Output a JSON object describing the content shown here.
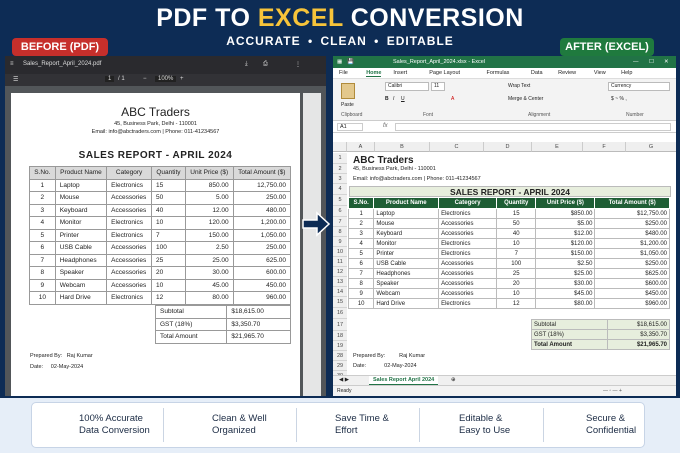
{
  "header": {
    "title_pre": "PDF TO ",
    "title_hl": "EXCEL",
    "title_post": " CONVERSION",
    "subtitle": "ACCURATE • CLEAN • EDITABLE",
    "before_label": "BEFORE (PDF)",
    "after_label": "AFTER (EXCEL)"
  },
  "pdf": {
    "filename": "Sales_Report_April_2024.pdf",
    "page": "1",
    "of": "/ 1",
    "zoom": "100%",
    "company": "ABC Traders",
    "address": "45, Business Park, Delhi - 110001",
    "contact": "Email: info@abctraders.com | Phone: 011-41234567",
    "report_title": "SALES REPORT - APRIL 2024",
    "columns": [
      "S.No.",
      "Product Name",
      "Category",
      "Quantity",
      "Unit Price ($)",
      "Total Amount ($)"
    ],
    "rows": [
      [
        "1",
        "Laptop",
        "Electronics",
        "15",
        "850.00",
        "12,750.00"
      ],
      [
        "2",
        "Mouse",
        "Accessories",
        "50",
        "5.00",
        "250.00"
      ],
      [
        "3",
        "Keyboard",
        "Accessories",
        "40",
        "12.00",
        "480.00"
      ],
      [
        "4",
        "Monitor",
        "Electronics",
        "10",
        "120.00",
        "1,200.00"
      ],
      [
        "5",
        "Printer",
        "Electronics",
        "7",
        "150.00",
        "1,050.00"
      ],
      [
        "6",
        "USB Cable",
        "Accessories",
        "100",
        "2.50",
        "250.00"
      ],
      [
        "7",
        "Headphones",
        "Accessories",
        "25",
        "25.00",
        "625.00"
      ],
      [
        "8",
        "Speaker",
        "Accessories",
        "20",
        "30.00",
        "600.00"
      ],
      [
        "9",
        "Webcam",
        "Accessories",
        "10",
        "45.00",
        "450.00"
      ],
      [
        "10",
        "Hard Drive",
        "Electronics",
        "12",
        "80.00",
        "960.00"
      ]
    ],
    "totals": [
      [
        "Subtotal",
        "$18,615.00"
      ],
      [
        "GST (18%)",
        "$3,350.70"
      ],
      [
        "Total Amount",
        "$21,965.70"
      ]
    ],
    "prepared_label": "Prepared By:",
    "prepared_value": "Raj Kumar",
    "date_label": "Date:",
    "date_value": "02-May-2024"
  },
  "excel": {
    "title": "Sales_Report_April_2024.xlsx - Excel",
    "menu": [
      "File",
      "Home",
      "Insert",
      "Page Layout",
      "Formulas",
      "Data",
      "Review",
      "View",
      "Help"
    ],
    "font": "Calibri",
    "font_size": "11",
    "number_format": "Currency",
    "wrap_text": "Wrap Text",
    "merge": "Merge & Center",
    "paste": "Paste",
    "groups": [
      "Clipboard",
      "Font",
      "Alignment",
      "Number"
    ],
    "name_box": "A1",
    "col_letters": [
      "A",
      "B",
      "C",
      "D",
      "E",
      "F",
      "G"
    ],
    "row_numbers": [
      "1",
      "2",
      "3",
      "4",
      "5",
      "6",
      "7",
      "8",
      "9",
      "10",
      "11",
      "12",
      "13",
      "14",
      "15",
      "16",
      "17",
      "18",
      "19",
      "28",
      "29",
      "30"
    ],
    "company": "ABC Traders",
    "address": "45, Business Park, Delhi - 110001",
    "contact": "Email: info@abctraders.com | Phone: 011-41234567",
    "report_title": "SALES REPORT - APRIL 2024",
    "columns": [
      "S.No.",
      "Product Name",
      "Category",
      "Quantity",
      "Unit Price ($)",
      "Total Amount ($)"
    ],
    "rows": [
      [
        "1",
        "Laptop",
        "Electronics",
        "15",
        "$850.00",
        "$12,750.00"
      ],
      [
        "2",
        "Mouse",
        "Accessories",
        "50",
        "$5.00",
        "$250.00"
      ],
      [
        "3",
        "Keyboard",
        "Accessories",
        "40",
        "$12.00",
        "$480.00"
      ],
      [
        "4",
        "Monitor",
        "Electronics",
        "10",
        "$120.00",
        "$1,200.00"
      ],
      [
        "5",
        "Printer",
        "Electronics",
        "7",
        "$150.00",
        "$1,050.00"
      ],
      [
        "6",
        "USB Cable",
        "Accessories",
        "100",
        "$2.50",
        "$250.00"
      ],
      [
        "7",
        "Headphones",
        "Accessories",
        "25",
        "$25.00",
        "$625.00"
      ],
      [
        "8",
        "Speaker",
        "Accessories",
        "20",
        "$30.00",
        "$600.00"
      ],
      [
        "9",
        "Webcam",
        "Accessories",
        "10",
        "$45.00",
        "$450.00"
      ],
      [
        "10",
        "Hard Drive",
        "Electronics",
        "12",
        "$80.00",
        "$960.00"
      ]
    ],
    "totals": [
      [
        "Subtotal",
        "$18,615.00"
      ],
      [
        "GST (18%)",
        "$3,350.70"
      ],
      [
        "Total Amount",
        "$21,965.70"
      ]
    ],
    "prepared_label": "Prepared By:",
    "prepared_value": "Raj Kumar",
    "date_label": "Date:",
    "date_value": "02-May-2024",
    "sheet_tab": "Sales Report April 2024",
    "status": "Ready"
  },
  "features": [
    {
      "line1": "100% Accurate",
      "line2": "Data Conversion",
      "icon": "target-icon"
    },
    {
      "line1": "Clean & Well",
      "line2": "Organized",
      "icon": "grid-icon"
    },
    {
      "line1": "Save Time &",
      "line2": "Effort",
      "icon": "clock-icon"
    },
    {
      "line1": "Editable &",
      "line2": "Easy to Use",
      "icon": "edit-document-icon"
    },
    {
      "line1": "Secure &",
      "line2": "Confidential",
      "icon": "shield-check-icon"
    }
  ],
  "colors": {
    "navy": "#0d2c55",
    "accent": "#f7c43a",
    "excel_green": "#217346",
    "pdf_red": "#c62f2b"
  }
}
